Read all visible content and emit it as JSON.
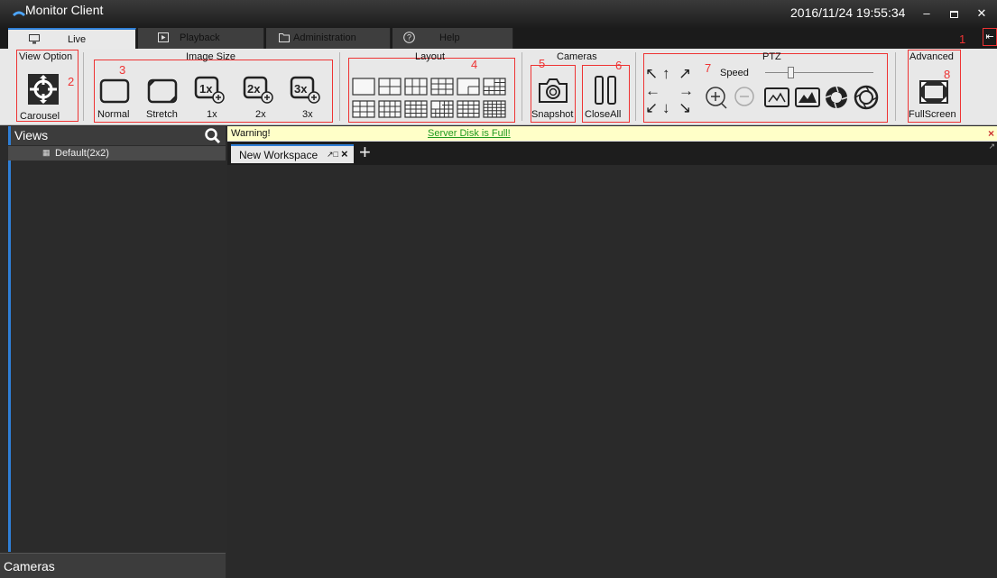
{
  "window": {
    "title": "Monitor Client",
    "datetime": "2016/11/24 19:55:34"
  },
  "tabs": [
    {
      "label": "Live",
      "icon": "monitor-icon"
    },
    {
      "label": "Playback",
      "icon": "play-icon"
    },
    {
      "label": "Administration",
      "icon": "folder-icon"
    },
    {
      "label": "Help",
      "icon": "help-icon"
    }
  ],
  "annotations": {
    "n1": "1",
    "n2": "2",
    "n3": "3",
    "n4": "4",
    "n5": "5",
    "n6": "6",
    "n7": "7",
    "n8": "8"
  },
  "ribbon": {
    "view_option": {
      "title": "View Option",
      "carousel": "Carousel"
    },
    "image_size": {
      "title": "Image Size",
      "normal": "Normal",
      "stretch": "Stretch",
      "x1": "1x",
      "x2": "2x",
      "x3": "3x"
    },
    "layout": {
      "title": "Layout"
    },
    "cameras": {
      "title": "Cameras",
      "snapshot": "Snapshot",
      "close_all": "CloseAll"
    },
    "ptz": {
      "title": "PTZ",
      "speed": "Speed",
      "speed_value_fraction": 0.22
    },
    "advanced": {
      "title": "Advanced",
      "fullscreen": "FullScreen"
    }
  },
  "left_panel": {
    "views_title": "Views",
    "views_items": [
      "Default(2x2)"
    ],
    "cameras_title": "Cameras"
  },
  "warning": {
    "label": "Warning!",
    "message": "Server Disk is Full!"
  },
  "workspace": {
    "tab_label": "New Workspace"
  },
  "colors": {
    "accent": "#2f7fd6",
    "annotation": "#e33333",
    "warning_bg": "#ffffc8",
    "warning_link": "#1f9a1f"
  }
}
